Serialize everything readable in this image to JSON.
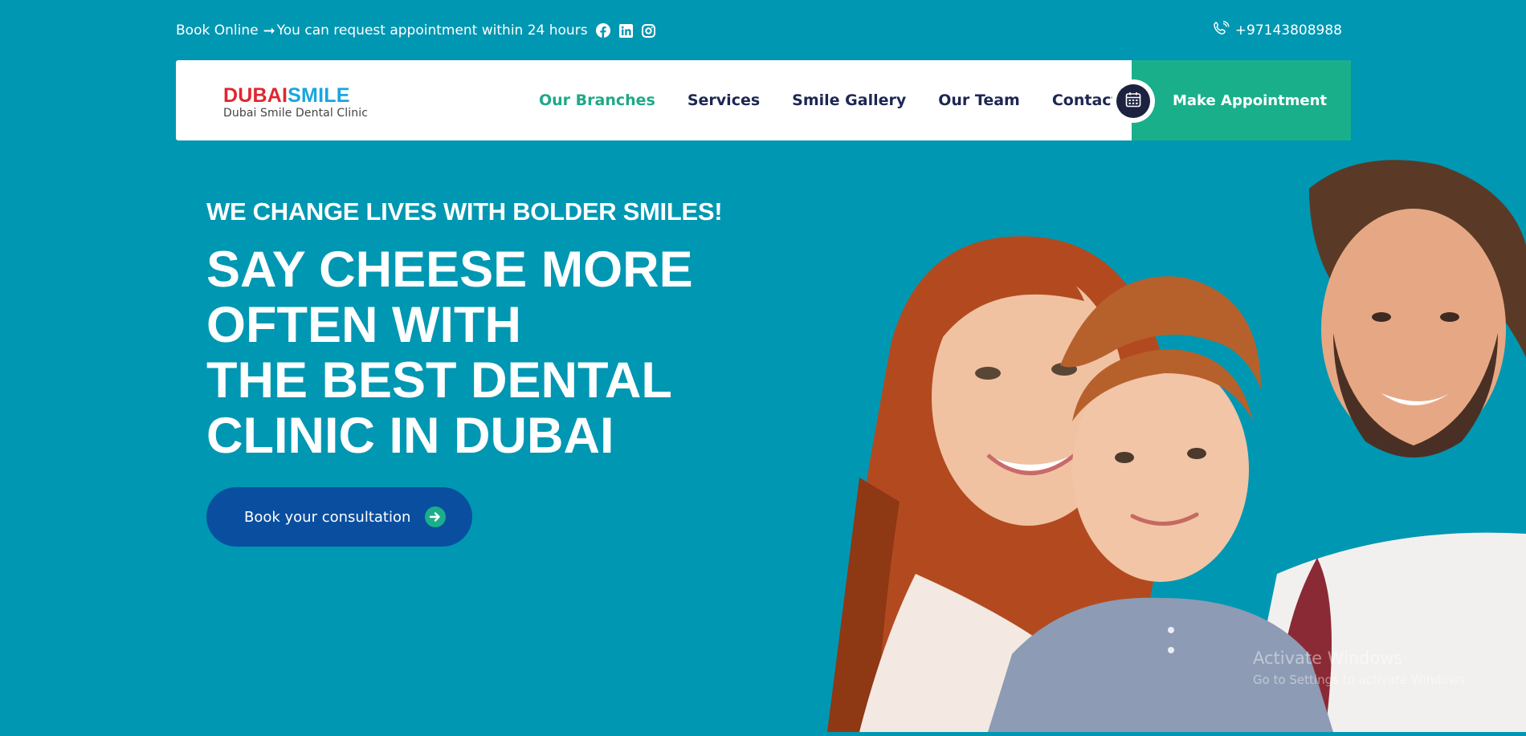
{
  "topbar": {
    "book_online": "Book Online",
    "arrow": "➞",
    "request_text": "You can request appointment within 24 hours",
    "social_icons": [
      "facebook-icon",
      "linkedin-icon",
      "instagram-icon"
    ],
    "phone": "+97143808988"
  },
  "logo": {
    "word_dubai": "DUBAI",
    "word_smile": "SMILE",
    "subtitle": "Dubai Smile Dental Clinic"
  },
  "nav": {
    "items": [
      {
        "label": "Our Branches",
        "active": true
      },
      {
        "label": "Services"
      },
      {
        "label": "Smile Gallery"
      },
      {
        "label": "Our Team"
      },
      {
        "label": "Contact Us"
      }
    ],
    "appointment_label": "Make Appointment"
  },
  "hero": {
    "tagline": "WE CHANGE LIVES WITH BOLDER SMILES!",
    "headline_lines": [
      "SAY CHEESE MORE",
      "OFTEN WITH",
      "THE BEST DENTAL",
      "CLINIC IN DUBAI"
    ],
    "cta_label": "Book your consultation"
  },
  "watermark": {
    "line1": "Activate Windows",
    "line2": "Go to Settings to activate Windows."
  },
  "colors": {
    "background": "#0097b2",
    "accent_green": "#1aaf8b",
    "nav_text": "#1d2752",
    "cta_blue": "#0a4f9f",
    "logo_red": "#e0262f",
    "logo_blue": "#17a6df"
  }
}
